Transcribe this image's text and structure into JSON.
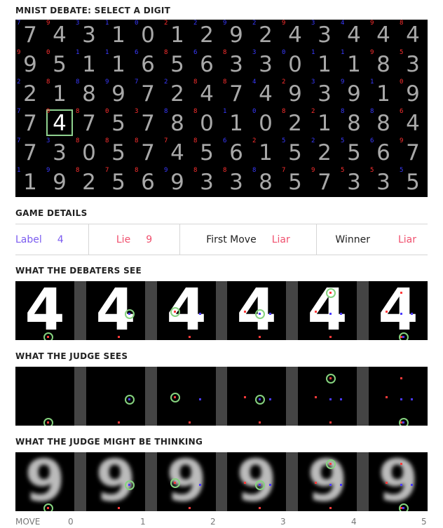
{
  "title": "MNIST DEBATE: SELECT A DIGIT",
  "colors": {
    "blue": "#3a3aff",
    "red": "#ff3030",
    "accent_label": "#7b5cf0",
    "accent_lie": "#f0506e",
    "circle": "#86d37f"
  },
  "grid": [
    [
      [
        "7",
        "b",
        "7"
      ],
      [
        "9",
        "r",
        "4"
      ],
      [
        "3",
        "b",
        "3"
      ],
      [
        "1",
        "b",
        "1"
      ],
      [
        "0",
        "b",
        "0"
      ],
      [
        "2",
        "r",
        "1"
      ],
      [
        "2",
        "b",
        "2"
      ],
      [
        "9",
        "b",
        "9"
      ],
      [
        "2",
        "b",
        "2"
      ],
      [
        "9",
        "r",
        "4"
      ],
      [
        "3",
        "b",
        "3"
      ],
      [
        "4",
        "b",
        "4"
      ],
      [
        "9",
        "r",
        "4"
      ],
      [
        "8",
        "r",
        "4"
      ]
    ],
    [
      [
        "9",
        "r",
        "9"
      ],
      [
        "0",
        "r",
        "5"
      ],
      [
        "1",
        "b",
        "1"
      ],
      [
        "1",
        "b",
        "1"
      ],
      [
        "6",
        "b",
        "6"
      ],
      [
        "8",
        "r",
        "5"
      ],
      [
        "6",
        "b",
        "6"
      ],
      [
        "8",
        "r",
        "3"
      ],
      [
        "3",
        "b",
        "3"
      ],
      [
        "0",
        "b",
        "0"
      ],
      [
        "1",
        "b",
        "1"
      ],
      [
        "1",
        "b",
        "1"
      ],
      [
        "9",
        "r",
        "8"
      ],
      [
        "5",
        "r",
        "3"
      ]
    ],
    [
      [
        "2",
        "b",
        "2"
      ],
      [
        "8",
        "r",
        "1"
      ],
      [
        "8",
        "b",
        "8"
      ],
      [
        "9",
        "b",
        "9"
      ],
      [
        "7",
        "b",
        "7"
      ],
      [
        "2",
        "b",
        "2"
      ],
      [
        "8",
        "r",
        "4"
      ],
      [
        "8",
        "r",
        "7"
      ],
      [
        "4",
        "b",
        "4"
      ],
      [
        "2",
        "r",
        "9"
      ],
      [
        "3",
        "b",
        "3"
      ],
      [
        "9",
        "b",
        "9"
      ],
      [
        "1",
        "b",
        "1"
      ],
      [
        "0",
        "r",
        "9"
      ]
    ],
    [
      [
        "7",
        "b",
        "7"
      ],
      [
        "9",
        "r",
        "4"
      ],
      [
        "8",
        "r",
        "7"
      ],
      [
        "0",
        "r",
        "5"
      ],
      [
        "3",
        "r",
        "7"
      ],
      [
        "8",
        "b",
        "8"
      ],
      [
        "8",
        "r",
        "0"
      ],
      [
        "1",
        "b",
        "1"
      ],
      [
        "0",
        "b",
        "0"
      ],
      [
        "8",
        "r",
        "2"
      ],
      [
        "2",
        "r",
        "1"
      ],
      [
        "8",
        "b",
        "8"
      ],
      [
        "8",
        "b",
        "8"
      ],
      [
        "6",
        "r",
        "4"
      ]
    ],
    [
      [
        "7",
        "b",
        "7"
      ],
      [
        "3",
        "b",
        "3"
      ],
      [
        "8",
        "r",
        "0"
      ],
      [
        "8",
        "r",
        "5"
      ],
      [
        "8",
        "r",
        "7"
      ],
      [
        "7",
        "r",
        "4"
      ],
      [
        "8",
        "r",
        "5"
      ],
      [
        "6",
        "b",
        "6"
      ],
      [
        "2",
        "r",
        "1"
      ],
      [
        "5",
        "b",
        "5"
      ],
      [
        "2",
        "b",
        "2"
      ],
      [
        "5",
        "b",
        "5"
      ],
      [
        "6",
        "b",
        "6"
      ],
      [
        "9",
        "r",
        "7"
      ]
    ],
    [
      [
        "1",
        "b",
        "1"
      ],
      [
        "9",
        "b",
        "9"
      ],
      [
        "8",
        "r",
        "2"
      ],
      [
        "7",
        "r",
        "5"
      ],
      [
        "8",
        "r",
        "6"
      ],
      [
        "9",
        "b",
        "9"
      ],
      [
        "8",
        "r",
        "3"
      ],
      [
        "8",
        "r",
        "3"
      ],
      [
        "8",
        "b",
        "8"
      ],
      [
        "7",
        "r",
        "5"
      ],
      [
        "9",
        "r",
        "7"
      ],
      [
        "5",
        "r",
        "3"
      ],
      [
        "5",
        "r",
        "3"
      ],
      [
        "5",
        "b",
        "5"
      ]
    ]
  ],
  "details": {
    "title": "GAME DETAILS",
    "label_key": "Label",
    "label_val": "4",
    "lie_key": "Lie",
    "lie_val": "9",
    "first_key": "First Move",
    "first_val": "Liar",
    "winner_key": "Winner",
    "winner_val": "Liar"
  },
  "sections": {
    "debaters": "WHAT THE DEBATERS SEE",
    "judge": "WHAT THE JUDGE SEES",
    "thinking": "WHAT THE JUDGE MIGHT BE THINKING"
  },
  "debater_digit": "4",
  "thinking_digit": "9",
  "axis": {
    "label": "MOVE",
    "ticks": [
      "0",
      "1",
      "2",
      "3",
      "4",
      "5"
    ]
  }
}
